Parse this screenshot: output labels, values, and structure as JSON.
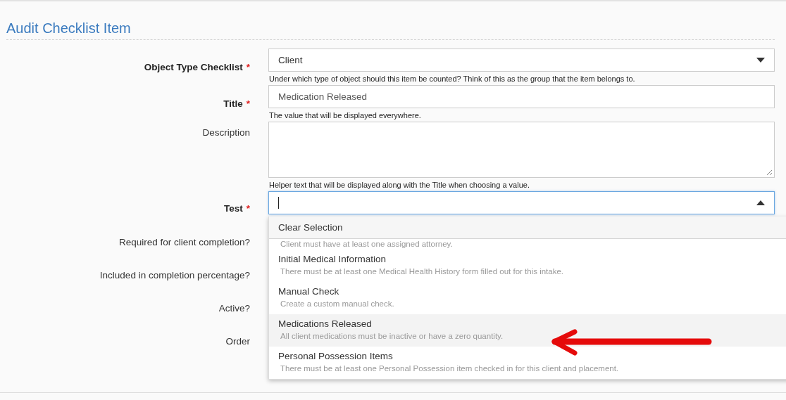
{
  "section_title": "Audit Checklist Item",
  "required_mark": "*",
  "fields": [
    {
      "kind": "select",
      "label": "Object Type Checklist",
      "required": true,
      "value": "Client",
      "open": false,
      "hint": "Under which type of object should this item be counted? Think of this as the group that the item belongs to."
    },
    {
      "kind": "text",
      "label": "Title",
      "required": true,
      "value": "Medication Released",
      "hint": "The value that will be displayed everywhere."
    },
    {
      "kind": "textarea",
      "label": "Description",
      "required": false,
      "hint": "Helper text that will be displayed along with the Title when choosing a value."
    },
    {
      "kind": "select",
      "label": "Test",
      "required": true,
      "open": true
    },
    {
      "kind": "covered",
      "label": "Required for client completion?",
      "required": false
    },
    {
      "kind": "covered",
      "label": "Included in completion percentage?",
      "required": false
    },
    {
      "kind": "covered",
      "label": "Active?",
      "required": false
    },
    {
      "kind": "covered",
      "label": "Order",
      "required": false
    }
  ],
  "dropdown": {
    "clear_label": "Clear Selection",
    "options": [
      {
        "description": "Client must have at least one assigned attorney.",
        "selected": false
      },
      {
        "title": "Initial Medical Information",
        "description": "There must be at least one Medical Health History form filled out for this intake.",
        "selected": false
      },
      {
        "title": "Manual Check",
        "description": "Create a custom manual check.",
        "selected": false
      },
      {
        "title": "Medications Released",
        "description": "All client medications must be inactive or have a zero quantity.",
        "selected": true
      },
      {
        "title": "Personal Possession Items",
        "description": "There must be at least one Personal Possession item checked in for this client and placement.",
        "selected": false
      }
    ]
  },
  "annotation": {
    "kind": "arrow"
  }
}
